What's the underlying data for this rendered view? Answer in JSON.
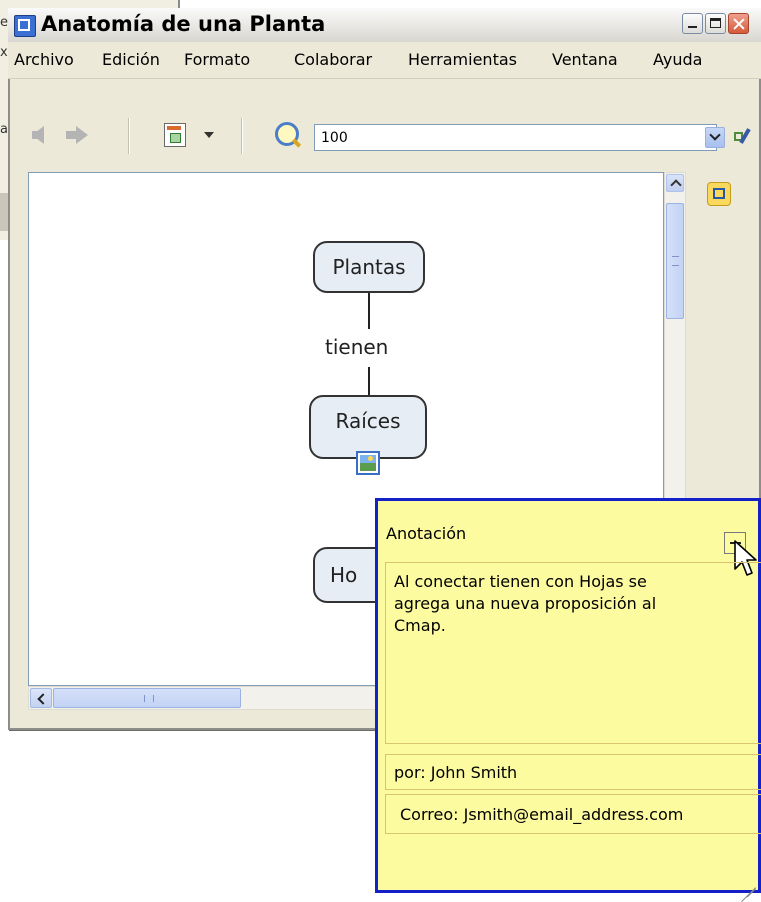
{
  "window": {
    "title": "Anatomía de una Planta"
  },
  "menubar": {
    "items": [
      "Archivo",
      "Edición",
      "Formato",
      "Colaborar",
      "Herramientas",
      "Ventana",
      "Ayuda"
    ]
  },
  "toolbar": {
    "zoom_value": "100"
  },
  "cmap": {
    "concepts": [
      "Plantas",
      "Raíces",
      "Ho"
    ],
    "link_label": "tienen"
  },
  "annotation": {
    "title": "Anotación",
    "text": "Al conectar tienen con Hojas se\nagrega una nueva proposición al\nCmap.",
    "author": "por: John Smith",
    "email": "Correo: Jsmith@email_address.com"
  },
  "colors": {
    "annotation_background": "#fdfba0",
    "annotation_border": "#1420c8",
    "concept_fill": "#e7edf4"
  }
}
